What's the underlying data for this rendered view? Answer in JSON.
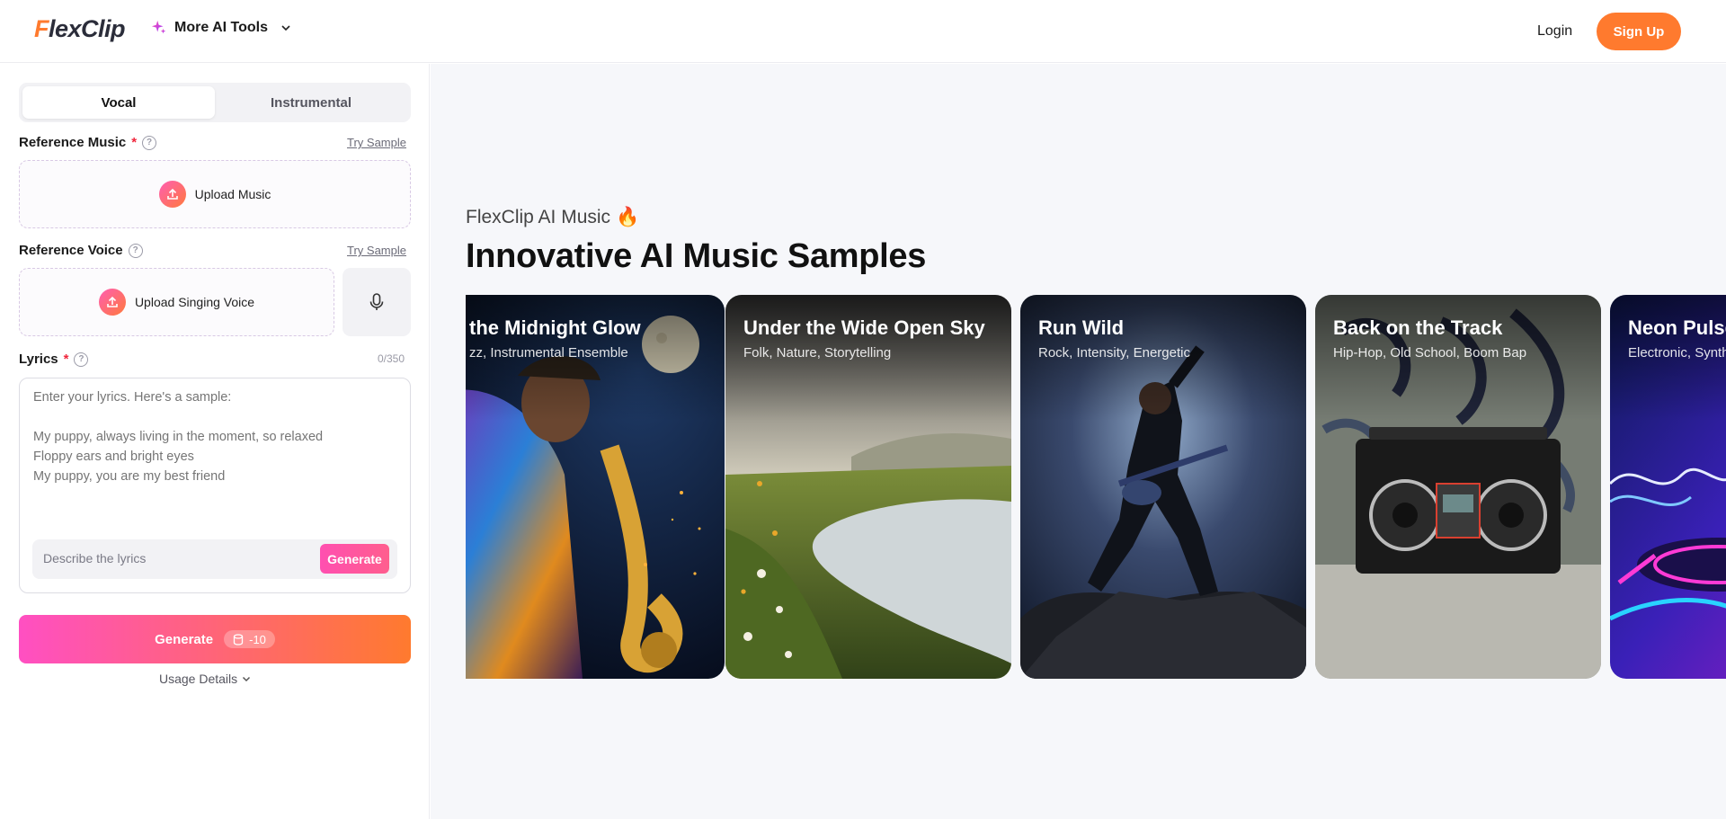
{
  "header": {
    "logo_first": "F",
    "logo_rest": "lexClip",
    "ai_tools_label": "More AI Tools",
    "login_label": "Login",
    "signup_label": "Sign Up"
  },
  "sidebar": {
    "tabs": [
      {
        "label": "Vocal",
        "active": true
      },
      {
        "label": "Instrumental",
        "active": false
      }
    ],
    "reference_music": {
      "label": "Reference Music",
      "required_mark": "*",
      "help": "?",
      "try_sample": "Try Sample",
      "upload_label": "Upload Music"
    },
    "reference_voice": {
      "label": "Reference Voice",
      "help": "?",
      "try_sample": "Try Sample",
      "upload_label": "Upload Singing Voice"
    },
    "lyrics": {
      "label": "Lyrics",
      "required_mark": "*",
      "help": "?",
      "counter": "0/350",
      "placeholder": "Enter your lyrics. Here's a sample:\n\nMy puppy, always living in the moment, so relaxed\nFloppy ears and bright eyes\nMy puppy, you are my best friend",
      "describe_placeholder": "Describe the lyrics",
      "generate_small_label": "Generate"
    },
    "generate_label": "Generate",
    "credit_cost": "-10",
    "usage_label": "Usage Details"
  },
  "main": {
    "eyebrow": "FlexClip AI Music",
    "eyebrow_emoji": "🔥",
    "headline": "Innovative AI Music Samples",
    "cards": [
      {
        "title": "In the Midnight Glow",
        "subtitle": "Jazz, Instrumental Ensemble",
        "visible_title": "the Midnight Glow",
        "visible_subtitle": "zz, Instrumental Ensemble"
      },
      {
        "title": "Under the Wide Open Sky",
        "subtitle": "Folk, Nature, Storytelling"
      },
      {
        "title": "Run Wild",
        "subtitle": "Rock, Intensity, Energetic"
      },
      {
        "title": "Back on the Track",
        "subtitle": "Hip-Hop, Old School, Boom Bap"
      },
      {
        "title": "Neon Pulse",
        "subtitle": "Electronic, Synth"
      }
    ]
  },
  "colors": {
    "accent_orange": "#ff7a2e",
    "accent_pink": "#ff4fc2",
    "required_red": "#f0263c"
  }
}
